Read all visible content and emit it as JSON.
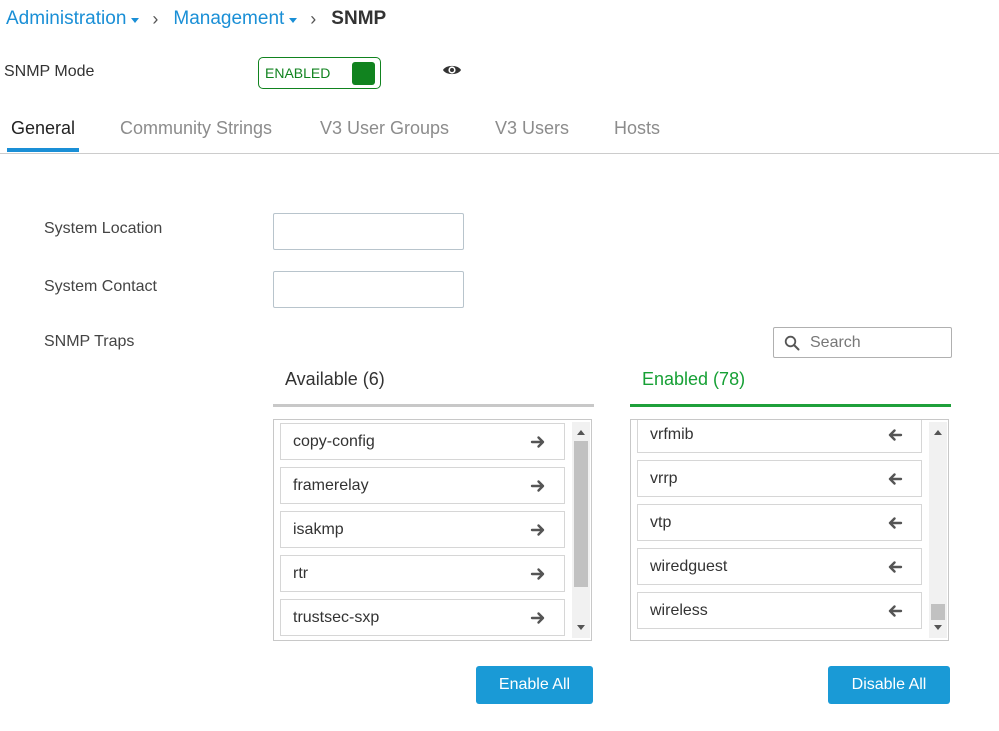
{
  "breadcrumb": {
    "items": [
      {
        "label": "Administration"
      },
      {
        "label": "Management"
      }
    ],
    "current": "SNMP"
  },
  "snmp_mode": {
    "label": "SNMP Mode",
    "toggle_text": "ENABLED",
    "toggle_color": "#11831f"
  },
  "tabs": [
    {
      "label": "General",
      "active": true
    },
    {
      "label": "Community Strings",
      "active": false
    },
    {
      "label": "V3 User Groups",
      "active": false
    },
    {
      "label": "V3 Users",
      "active": false
    },
    {
      "label": "Hosts",
      "active": false
    }
  ],
  "form": {
    "system_location": {
      "label": "System Location",
      "value": ""
    },
    "system_contact": {
      "label": "System Contact",
      "value": ""
    },
    "snmp_traps_label": "SNMP Traps"
  },
  "search": {
    "placeholder": "Search",
    "icon": "search-icon"
  },
  "available": {
    "header": "Available (6)",
    "items": [
      "copy-config",
      "framerelay",
      "isakmp",
      "rtr",
      "trustsec-sxp"
    ],
    "item_icon": "arrow-right-icon",
    "button_label": "Enable All"
  },
  "enabled": {
    "header": "Enabled (78)",
    "header_color": "#16a035",
    "items": [
      "vrfmib",
      "vrrp",
      "vtp",
      "wiredguest",
      "wireless"
    ],
    "item_icon": "arrow-left-icon",
    "button_label": "Disable All"
  },
  "colors": {
    "accent": "#1a8fd6",
    "button": "#1a9ad6",
    "enabled_green": "#11831f"
  }
}
